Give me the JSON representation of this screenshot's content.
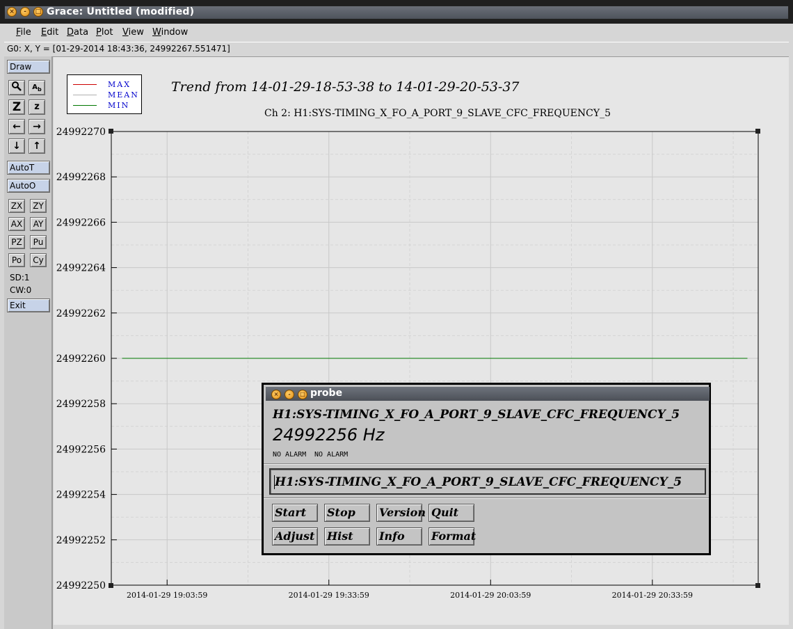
{
  "window": {
    "title": "Grace: Untitled (modified)"
  },
  "menu": [
    {
      "label": "File",
      "u": "F"
    },
    {
      "label": "Edit",
      "u": "E"
    },
    {
      "label": "Data",
      "u": "D"
    },
    {
      "label": "Plot",
      "u": "P"
    },
    {
      "label": "View",
      "u": "V"
    },
    {
      "label": "Window",
      "u": "W"
    }
  ],
  "status": {
    "text": "G0: X, Y = [01-29-2014 18:43:36, 24992267.551471]"
  },
  "toolbar": {
    "draw": "Draw",
    "autot": "AutoT",
    "autoo": "AutoO",
    "zx": "ZX",
    "zy": "ZY",
    "ax": "AX",
    "ay": "AY",
    "pz": "PZ",
    "pu": "Pu",
    "po": "Po",
    "cy": "Cy",
    "sd": "SD:1",
    "cw": "CW:0",
    "exit": "Exit"
  },
  "legend": {
    "max": "MAX",
    "mean": "MEAN",
    "min": "MIN"
  },
  "colors": {
    "max": "#cc0000",
    "mean": "#b0b0b0",
    "min": "#007700"
  },
  "chart_data": {
    "type": "line",
    "title": "Trend from 14-01-29-18-53-38 to 14-01-29-20-53-37",
    "subtitle": "Ch 2: H1:SYS-TIMING_X_FO_A_PORT_9_SLAVE_CFC_FREQUENCY_5",
    "xlabel": "",
    "ylabel": "",
    "x_range": [
      "2014-01-29 18:53:38",
      "2014-01-29 20:53:37"
    ],
    "ylim": [
      24992250,
      24992270
    ],
    "yticks": [
      24992250,
      24992252,
      24992254,
      24992256,
      24992258,
      24992260,
      24992262,
      24992264,
      24992266,
      24992268,
      24992270
    ],
    "xticks": [
      "2014-01-29 19:03:59",
      "2014-01-29 19:33:59",
      "2014-01-29 20:03:59",
      "2014-01-29 20:33:59"
    ],
    "grid": true,
    "series": [
      {
        "name": "MAX",
        "color": "#cc0000",
        "x": [
          "2014-01-29 18:55:38",
          "2014-01-29 20:51:37"
        ],
        "values": [
          24992260,
          24992260
        ]
      },
      {
        "name": "MEAN",
        "color": "#b0b0b0",
        "x": [
          "2014-01-29 18:55:38",
          "2014-01-29 20:51:37"
        ],
        "values": [
          24992260,
          24992260
        ]
      },
      {
        "name": "MIN",
        "color": "#007700",
        "x": [
          "2014-01-29 18:55:38",
          "2014-01-29 20:51:37"
        ],
        "values": [
          24992260,
          24992260
        ]
      }
    ]
  },
  "probe": {
    "title": "probe",
    "channel": "H1:SYS-TIMING_X_FO_A_PORT_9_SLAVE_CFC_FREQUENCY_5",
    "value": "24992256 Hz",
    "alarm1": "NO ALARM",
    "alarm2": "NO ALARM",
    "input": "H1:SYS-TIMING_X_FO_A_PORT_9_SLAVE_CFC_FREQUENCY_5",
    "buttons": {
      "start": "Start",
      "stop": "Stop",
      "version": "Version",
      "quit": "Quit",
      "adjust": "Adjust",
      "hist": "Hist",
      "info": "Info",
      "format": "Format"
    }
  }
}
